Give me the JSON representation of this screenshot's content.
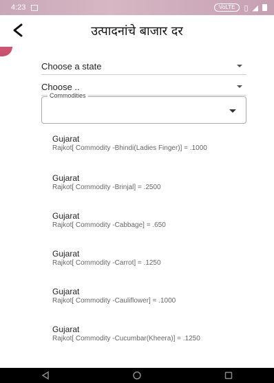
{
  "status_bar": {
    "time": "4:23",
    "network_badge": "VoLTE"
  },
  "toolbar": {
    "back_icon": "back-arrow-icon",
    "title": "उत्पादनांचे बाजार दर"
  },
  "filters": {
    "state_dropdown": {
      "value": "Choose a state"
    },
    "district_dropdown": {
      "value": "Choose .."
    },
    "commodities": {
      "label": "Commodities",
      "value": ""
    }
  },
  "prices": [
    {
      "state": "Gujarat",
      "detail": "Rajkot[ Commodity -Bhindi(Ladies Finger)] = .1000"
    },
    {
      "state": "Gujarat",
      "detail": "Rajkot[ Commodity -Brinjal] = .2500"
    },
    {
      "state": "Gujarat",
      "detail": "Rajkot[ Commodity -Cabbage] = .650"
    },
    {
      "state": "Gujarat",
      "detail": "Rajkot[ Commodity -Carrot] = .1250"
    },
    {
      "state": "Gujarat",
      "detail": "Rajkot[ Commodity -Cauliflower] = .1000"
    },
    {
      "state": "Gujarat",
      "detail": "Rajkot[ Commodity -Cucumbar(Kheera)] = .1250"
    }
  ],
  "nav": {
    "back": "nav-back-icon",
    "home": "nav-home-icon",
    "recents": "nav-recents-icon"
  },
  "colors": {
    "accent": "#c23c5c",
    "navbar": "#000000"
  }
}
